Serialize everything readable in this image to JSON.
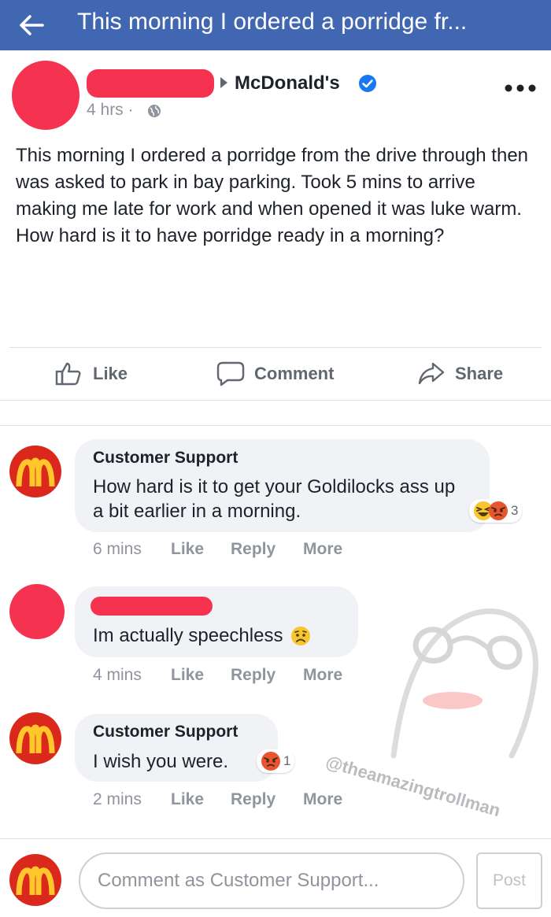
{
  "topbar": {
    "title": "This morning I ordered a porridge fr...",
    "back_icon": "arrow-left-icon"
  },
  "post": {
    "page_name": "McDonald's",
    "time": "4 hrs ·",
    "text": "This morning I ordered a porridge from the drive through then was asked to park in bay parking. Took 5 mins to arrive making me late for work and when opened it was luke warm. How hard is it to have porridge ready in a morning?"
  },
  "actions": {
    "like": "Like",
    "comment": "Comment",
    "share": "Share"
  },
  "comments": [
    {
      "author": "Customer Support",
      "text": "How hard is it to get your Goldilocks ass up a bit earlier in a morning.",
      "time": "6 mins",
      "reaction_count": "3",
      "reactions": [
        "haha-icon",
        "angry-icon"
      ]
    },
    {
      "author": "",
      "text": "Im actually speechless",
      "emoji": "sad-emoji-icon",
      "time": "4 mins"
    },
    {
      "author": "Customer Support",
      "text": "I wish you were.",
      "time": "2 mins",
      "reaction_count": "1",
      "reactions": [
        "angry-icon"
      ]
    }
  ],
  "comment_actions": {
    "like": "Like",
    "reply": "Reply",
    "more": "More"
  },
  "watermark": "@theamazingtrollman",
  "composer": {
    "placeholder": "Comment as Customer Support...",
    "post_label": "Post"
  },
  "colors": {
    "topbar": "#4267b2",
    "redaction": "#f5324f",
    "mcdonalds_red": "#da291c",
    "mcdonalds_yellow": "#ffc72c",
    "verified_blue": "#1877f2"
  }
}
